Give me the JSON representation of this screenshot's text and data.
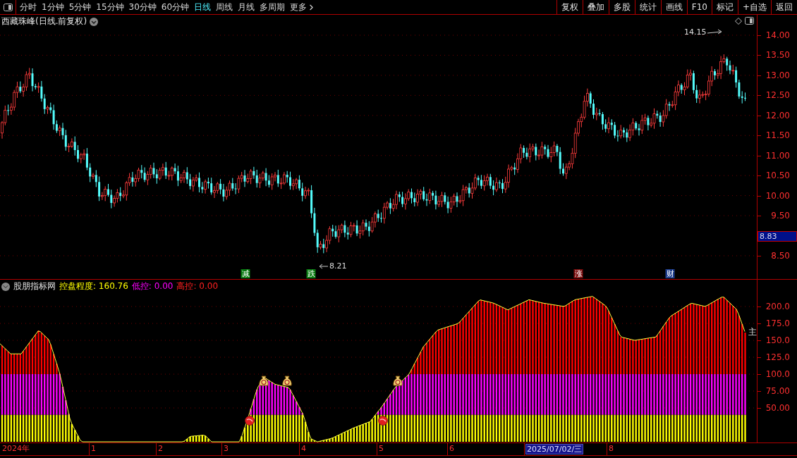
{
  "toolbar": {
    "tabs": [
      {
        "label": "分时",
        "selected": false
      },
      {
        "label": "1分钟",
        "selected": false
      },
      {
        "label": "5分钟",
        "selected": false
      },
      {
        "label": "15分钟",
        "selected": false
      },
      {
        "label": "30分钟",
        "selected": false
      },
      {
        "label": "60分钟",
        "selected": false
      },
      {
        "label": "日线",
        "selected": true
      },
      {
        "label": "周线",
        "selected": false
      },
      {
        "label": "月线",
        "selected": false
      },
      {
        "label": "多周期",
        "selected": false
      },
      {
        "label": "更多",
        "selected": false
      }
    ],
    "buttons": [
      "复权",
      "叠加",
      "多股",
      "统计",
      "画线",
      "F10",
      "标记",
      "+自选",
      "返回"
    ]
  },
  "chart": {
    "title": "西藏珠峰(日线.前复权)",
    "high_marker": "14.15",
    "low_marker": "8.21",
    "signals": [
      {
        "label": "减",
        "color": "#087a10"
      },
      {
        "label": "跌",
        "color": "#087a10"
      },
      {
        "label": "涨",
        "color": "#7a0c0c"
      },
      {
        "label": "财",
        "color": "#1c3c8c"
      }
    ],
    "price_ticks": [
      "14.00",
      "13.50",
      "13.00",
      "12.50",
      "12.00",
      "11.50",
      "11.00",
      "10.50",
      "10.00",
      "9.50",
      "8.50"
    ],
    "current_price": "8.83"
  },
  "indicator": {
    "name": "股朋指标网",
    "legend": [
      {
        "label": "控盘程度: 160.76",
        "color": "#ffff00"
      },
      {
        "label": "低控: 0.00",
        "color": "#ff00ff"
      },
      {
        "label": "高控: 0.00",
        "color": "#ff2020"
      }
    ],
    "side_label": "主",
    "ticks": [
      "200.0",
      "175.0",
      "150.0",
      "125.0",
      "100.0",
      "75.00",
      "50.00"
    ]
  },
  "time_axis": [
    {
      "label": "2024年",
      "selected": false
    },
    {
      "label": "1",
      "selected": false
    },
    {
      "label": "2",
      "selected": false
    },
    {
      "label": "3",
      "selected": false
    },
    {
      "label": "4",
      "selected": false
    },
    {
      "label": "5",
      "selected": false
    },
    {
      "label": "6",
      "selected": false
    },
    {
      "label": "2025/07/02/三",
      "selected": true
    },
    {
      "label": "8",
      "selected": false
    }
  ]
}
